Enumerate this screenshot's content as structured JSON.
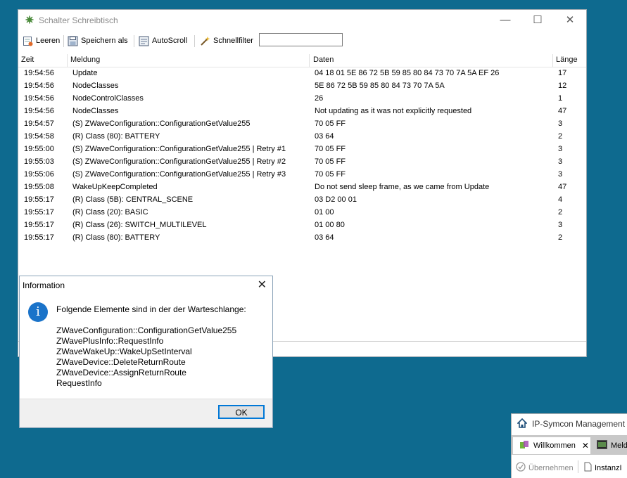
{
  "window": {
    "title": "Schalter Schreibtisch",
    "controls": {
      "minimize": "—",
      "maximize": "☐",
      "close": "✕"
    }
  },
  "toolbar": {
    "clear_label": "Leeren",
    "save_label": "Speichern als",
    "autoscroll_label": "AutoScroll",
    "quickfilter_label": "Schnellfilter",
    "filter_value": ""
  },
  "table": {
    "columns": [
      "Zeit",
      "Meldung",
      "Daten",
      "Länge"
    ],
    "rows": [
      {
        "time": "19:54:56",
        "msg": "Update",
        "data": "04 18 01 5E 86 72 5B 59 85 80 84 73 70 7A 5A EF 26",
        "len": "17"
      },
      {
        "time": "19:54:56",
        "msg": "NodeClasses",
        "data": "5E 86 72 5B 59 85 80 84 73 70 7A 5A",
        "len": "12"
      },
      {
        "time": "19:54:56",
        "msg": "NodeControlClasses",
        "data": "26",
        "len": "1"
      },
      {
        "time": "19:54:56",
        "msg": "NodeClasses",
        "data": "Not updating as it was not explicitly requested",
        "len": "47"
      },
      {
        "time": "19:54:57",
        "msg": "(S) ZWaveConfiguration::ConfigurationGetValue255",
        "data": "70 05 FF",
        "len": "3"
      },
      {
        "time": "19:54:58",
        "msg": "(R) Class (80): BATTERY",
        "data": "03 64",
        "len": "2"
      },
      {
        "time": "19:55:00",
        "msg": "(S) ZWaveConfiguration::ConfigurationGetValue255 | Retry #1",
        "data": "70 05 FF",
        "len": "3"
      },
      {
        "time": "19:55:03",
        "msg": "(S) ZWaveConfiguration::ConfigurationGetValue255 | Retry #2",
        "data": "70 05 FF",
        "len": "3"
      },
      {
        "time": "19:55:06",
        "msg": "(S) ZWaveConfiguration::ConfigurationGetValue255 | Retry #3",
        "data": "70 05 FF",
        "len": "3"
      },
      {
        "time": "19:55:08",
        "msg": "WakeUpKeepCompleted",
        "data": "Do not send sleep frame, as we came from Update",
        "len": "47"
      },
      {
        "time": "19:55:17",
        "msg": "(R) Class (5B): CENTRAL_SCENE",
        "data": "03 D2 00 01",
        "len": "4"
      },
      {
        "time": "19:55:17",
        "msg": "(R) Class (20): BASIC",
        "data": "01 00",
        "len": "2"
      },
      {
        "time": "19:55:17",
        "msg": "(R) Class (26): SWITCH_MULTILEVEL",
        "data": "01 00 80",
        "len": "3"
      },
      {
        "time": "19:55:17",
        "msg": "(R) Class (80): BATTERY",
        "data": "03 64",
        "len": "2"
      }
    ]
  },
  "dialog": {
    "title": "Information",
    "close": "✕",
    "icon": "i",
    "heading": "Folgende Elemente sind in der der Warteschlange:",
    "items": [
      "ZWaveConfiguration::ConfigurationGetValue255",
      "ZWavePlusInfo::RequestInfo",
      "ZWaveWakeUp::WakeUpSetInterval",
      "ZWaveDevice::DeleteReturnRoute",
      "ZWaveDevice::AssignReturnRoute",
      "RequestInfo"
    ],
    "ok_label": "OK"
  },
  "management": {
    "title": "IP-Symcon Management",
    "tab_welcome": "Willkommen",
    "tab_close": "✕",
    "tab_messages": "Meld",
    "apply_label": "Übernehmen",
    "instance_label": "InstanzI"
  },
  "colors": {
    "desktop": "#0e6a8f",
    "accent": "#0078d7",
    "info": "#1a73c9"
  }
}
